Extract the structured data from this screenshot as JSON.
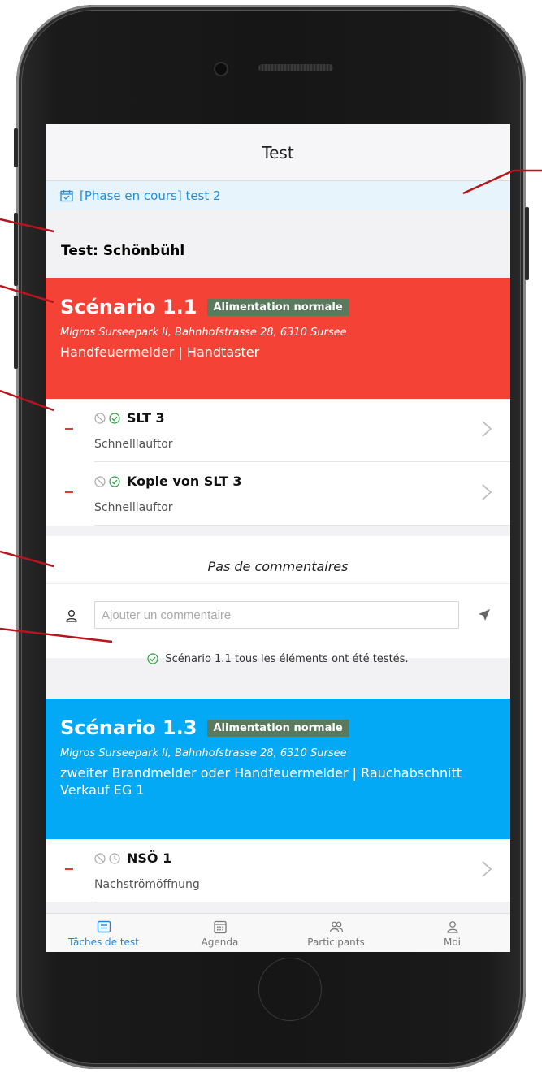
{
  "header": {
    "title": "Test"
  },
  "phase": {
    "label": "[Phase en cours] test 2"
  },
  "test_title": "Test: Schönbühl",
  "scenarios": [
    {
      "title": "Scénario 1.1",
      "tag": "Alimentation normale",
      "address": "Migros Surseepark II, Bahnhofstrasse 28, 6310 Sursee",
      "description": "Handfeuermelder | Handtaster",
      "color": "#f44336",
      "items": [
        {
          "name": "SLT 3",
          "subtitle": "Schnelllauftor"
        },
        {
          "name": "Kopie von SLT 3",
          "subtitle": "Schnelllauftor"
        }
      ]
    },
    {
      "title": "Scénario 1.3",
      "tag": "Alimentation normale",
      "address": "Migros Surseepark II, Bahnhofstrasse 28, 6310 Sursee",
      "description": "zweiter Brandmelder oder Handfeuermelder | Rauchabschnitt Verkauf EG 1",
      "color": "#03a9f4",
      "items": [
        {
          "name": "NSÖ 1",
          "subtitle": "Nachströmöffnung"
        }
      ]
    }
  ],
  "comments": {
    "empty_label": "Pas de commentaires",
    "placeholder": "Ajouter un commentaire",
    "status": "Scénario 1.1 tous les éléments ont été testés."
  },
  "tabs": [
    {
      "label": "Tâches de test",
      "icon": "tasks-icon",
      "active": true
    },
    {
      "label": "Agenda",
      "icon": "calendar-icon",
      "active": false
    },
    {
      "label": "Participants",
      "icon": "participants-icon",
      "active": false
    },
    {
      "label": "Moi",
      "icon": "user-icon",
      "active": false
    }
  ],
  "colors": {
    "accent": "#1e88e5",
    "danger": "#e53935",
    "success": "#2e9e3e",
    "tag": "#5a7a5e"
  }
}
